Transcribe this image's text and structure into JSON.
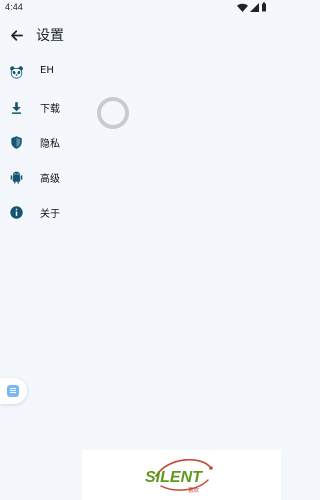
{
  "status_bar": {
    "time": "4:44",
    "icons": [
      "wifi-icon",
      "signal-icon",
      "battery-icon"
    ]
  },
  "app_bar": {
    "title": "设置",
    "back_icon": "arrow-left-icon"
  },
  "menu": [
    {
      "label": "EH",
      "icon": "panda-icon"
    },
    {
      "label": "下载",
      "icon": "download-icon"
    },
    {
      "label": "隐私",
      "icon": "shield-icon"
    },
    {
      "label": "高级",
      "icon": "android-icon"
    },
    {
      "label": "关于",
      "icon": "info-icon"
    }
  ],
  "loading": {
    "icon": "loading-spinner-icon"
  },
  "floating_button": {
    "icon": "note-icon"
  },
  "watermark": {
    "brand": "SILENT",
    "subtext": "喜欢"
  },
  "colors": {
    "background": "#f4f8fc",
    "icon_primary": "#17556f",
    "spinner": "#c8cbcf",
    "watermark_green": "#5d9a1d",
    "watermark_red": "#cc3b2a"
  }
}
